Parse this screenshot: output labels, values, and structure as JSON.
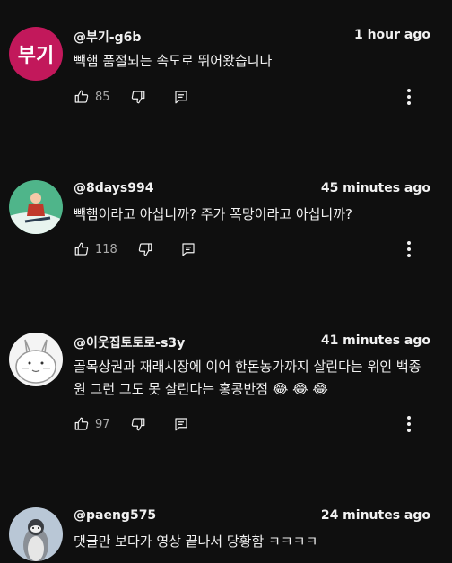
{
  "comments": [
    {
      "author": "@부기-g6b",
      "avatar_text": "부기",
      "time": "1 hour ago",
      "text": "빽햄 품절되는 속도로 뛰어왔습니다",
      "likes": "85"
    },
    {
      "author": "@8days994",
      "time": "45 minutes ago",
      "text": "빽햄이라고 아십니까? 주가 폭망이라고 아십니까?",
      "likes": "118"
    },
    {
      "author": "@이웃집토토로-s3y",
      "time": "41 minutes ago",
      "text": "골목상권과 재래시장에 이어 한돈농가까지 살린다는 위인 백종원 그런 그도 못 살린다는 홍콩반점",
      "emoji": "😂 😂 😂",
      "likes": "97"
    },
    {
      "author": "@paeng575",
      "time": "24 minutes ago",
      "text": "댓글만 보다가 영상 끝나서 당황함 ㅋㅋㅋㅋ"
    }
  ],
  "icons": {
    "like": "thumbs-up-icon",
    "dislike": "thumbs-down-icon",
    "reply": "reply-icon",
    "more": "more-vert-icon"
  },
  "colors": {
    "background": "#0f0f0f",
    "text": "#f1f1f1",
    "secondary": "#aaaaaa",
    "avatar_pink": "#c2185b"
  }
}
